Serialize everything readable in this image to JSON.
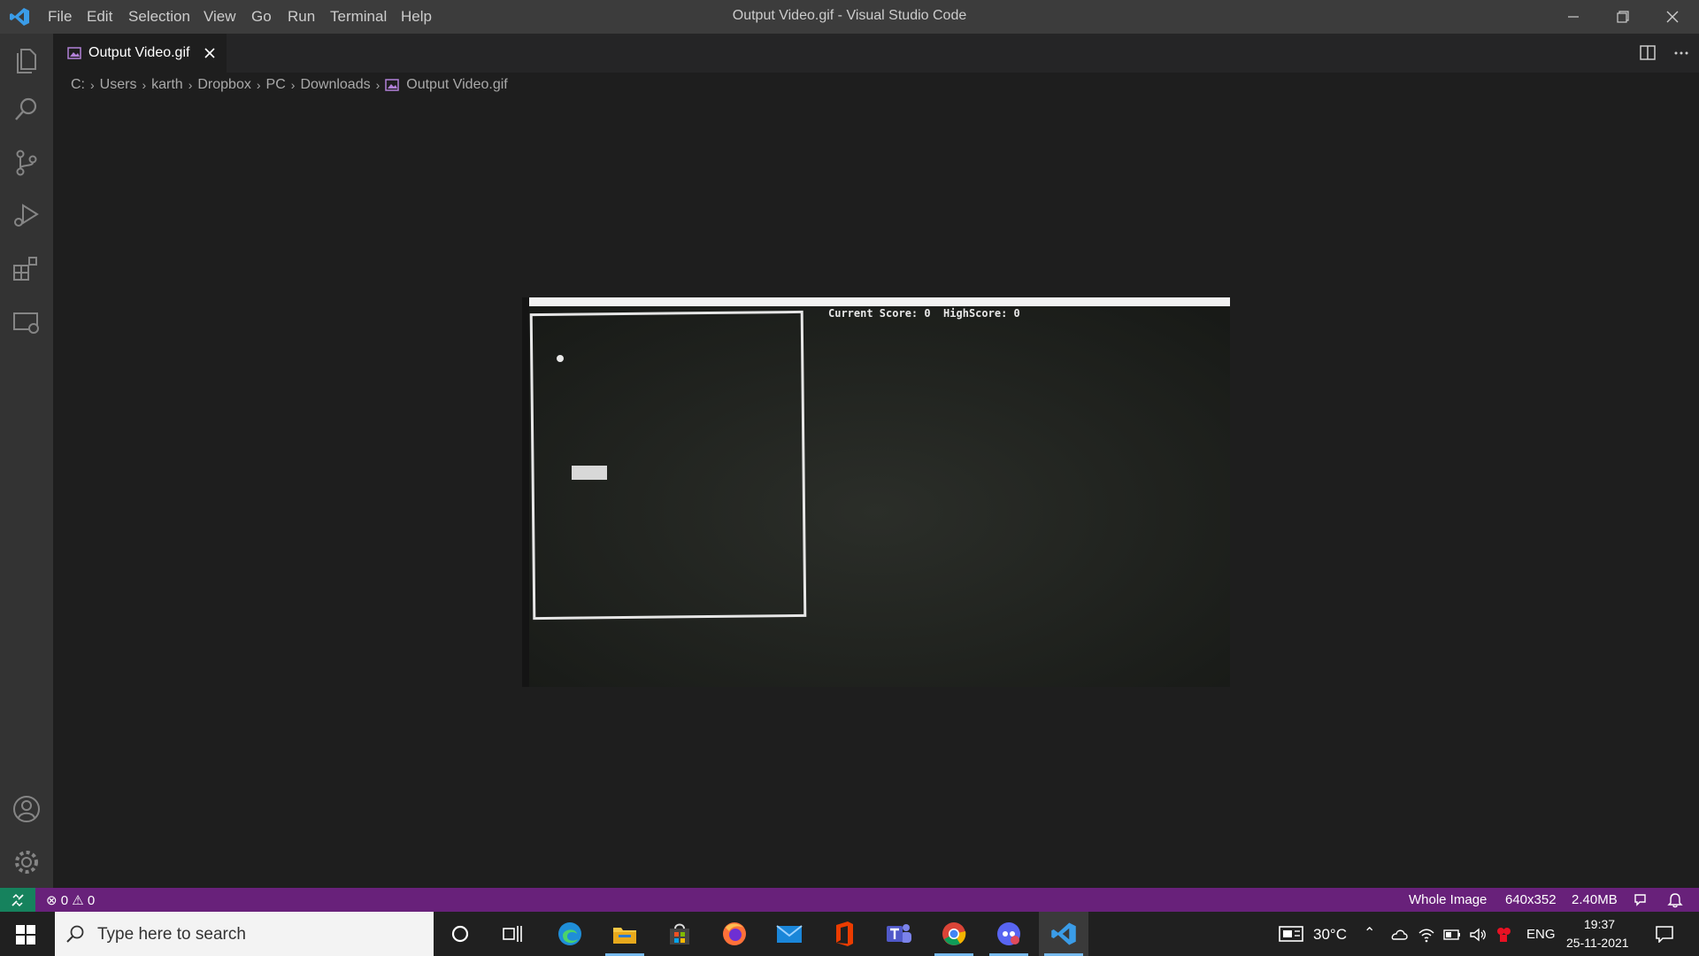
{
  "titlebar": {
    "title": "Output Video.gif - Visual Studio Code",
    "menu": [
      "File",
      "Edit",
      "Selection",
      "View",
      "Go",
      "Run",
      "Terminal",
      "Help"
    ]
  },
  "tab": {
    "label": "Output Video.gif"
  },
  "breadcrumb": [
    "C:",
    "Users",
    "karth",
    "Dropbox",
    "PC",
    "Downloads",
    "Output Video.gif"
  ],
  "gif": {
    "score_text": "Current Score: 0  HighScore: 0"
  },
  "statusbar": {
    "errors": "0",
    "warnings": "0",
    "zoom": "Whole Image",
    "dimensions": "640x352",
    "filesize": "2.40MB"
  },
  "taskbar": {
    "search_placeholder": "Type here to search",
    "weather": "30°C",
    "language": "ENG",
    "time": "19:37",
    "date": "25-11-2021"
  },
  "colors": {
    "accent": "#007acc",
    "statusbar": "#68217a",
    "titlebar": "#3c3c3c"
  }
}
